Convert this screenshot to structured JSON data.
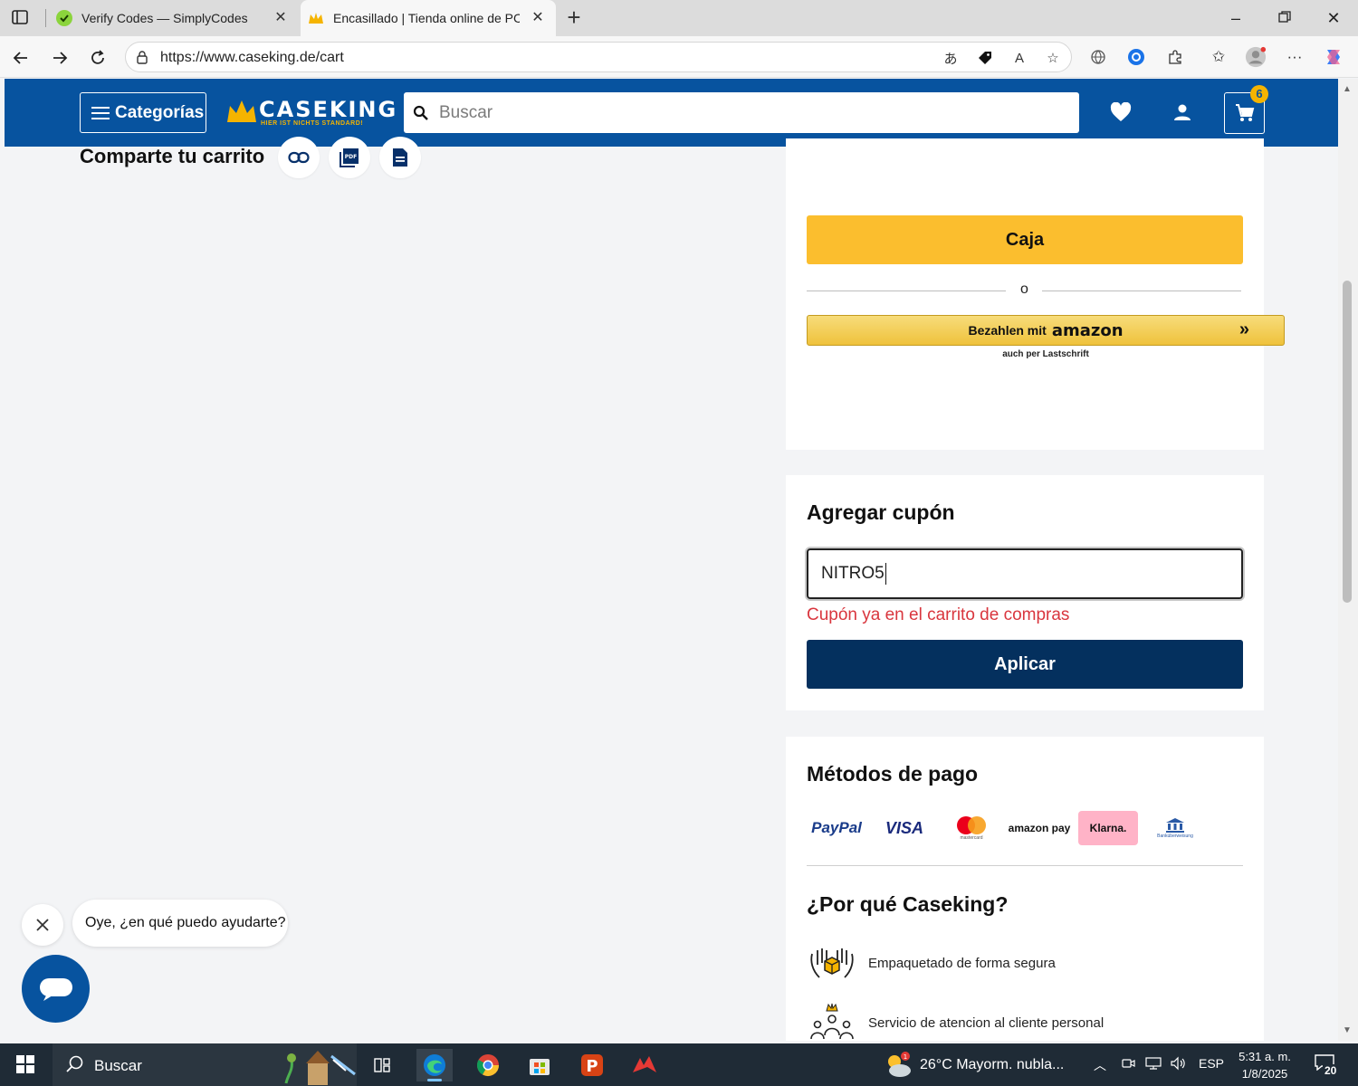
{
  "browser": {
    "tabs": [
      {
        "title": "Verify Codes — SimplyCodes"
      },
      {
        "title": "Encasillado | Tienda online de PC"
      }
    ],
    "url": "https://www.caseking.de/cart"
  },
  "header": {
    "categories_label": "Categorías",
    "brand": "CASEKING",
    "tagline": "HIER IST NICHTS STANDARD!",
    "search_placeholder": "Buscar",
    "cart_count": "6"
  },
  "share": {
    "title": "Comparte tu carrito"
  },
  "checkout": {
    "button_label": "Caja",
    "or_label": "o",
    "amazon_prefix": "Bezahlen mit",
    "amazon_brand": "amazon",
    "amazon_sub": "auch per Lastschrift"
  },
  "coupon": {
    "title": "Agregar cupón",
    "input_value": "NITRO5",
    "error": "Cupón ya en el carrito de compras",
    "apply_label": "Aplicar"
  },
  "payment": {
    "title": "Métodos de pago",
    "methods": [
      "PayPal",
      "VISA",
      "mastercard",
      "amazon pay",
      "Klarna.",
      "Banküberweisung"
    ]
  },
  "why": {
    "title": "¿Por qué Caseking?",
    "items": [
      "Empaquetado de forma segura",
      "Servicio de atencion al cliente personal"
    ]
  },
  "chat": {
    "prompt": "Oye, ¿en qué puedo ayudarte?"
  },
  "taskbar": {
    "search_label": "Buscar",
    "weather": "26°C  Mayorm. nubla...",
    "language": "ESP",
    "time": "5:31 a. m.",
    "date": "1/8/2025",
    "notifications": "20",
    "weather_badge": "1"
  },
  "colors": {
    "header_blue": "#07539f",
    "checkout_yellow": "#fbbe2e",
    "apply_navy": "#04305e",
    "error_red": "#d9363e"
  }
}
